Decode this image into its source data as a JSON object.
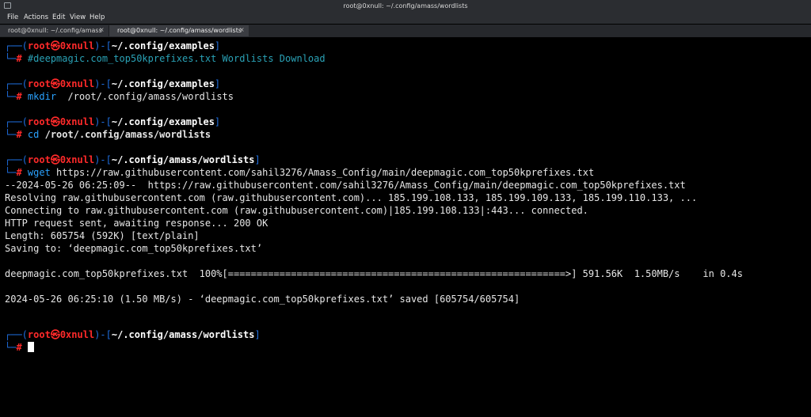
{
  "window": {
    "title": "root@0xnull: ~/.config/amass/wordlists"
  },
  "menu": {
    "file": "File",
    "actions": "Actions",
    "edit": "Edit",
    "view": "View",
    "help": "Help"
  },
  "tabs": [
    {
      "label": "root@0xnull: ~/.config/amass"
    },
    {
      "label": "root@0xnull: ~/.config/amass/wordlists"
    }
  ],
  "tab_close": "×",
  "prompt": {
    "open": "┌──(",
    "user": "root",
    "skull": "㉿",
    "host": "0xnull",
    "mid": ")-[",
    "close": "]",
    "second": "└─",
    "hash": "#"
  },
  "blocks": [
    {
      "path": "~/.config/examples",
      "command": "#deepmagic.com_top50kprefixes.txt Wordlists Download"
    },
    {
      "path": "~/.config/examples",
      "command_name": "mkdir",
      "command_args": "  /root/.config/amass/wordlists"
    },
    {
      "path": "~/.config/examples",
      "command_name": "cd",
      "command_args": " /root/.config/amass/wordlists"
    },
    {
      "path": "~/.config/amass/wordlists",
      "command_name": "wget",
      "command_args": " https://raw.githubusercontent.com/sahil3276/Amass_Config/main/deepmagic.com_top50kprefixes.txt"
    },
    {
      "path": "~/.config/amass/wordlists"
    }
  ],
  "output": [
    "--2024-05-26 06:25:09--  https://raw.githubusercontent.com/sahil3276/Amass_Config/main/deepmagic.com_top50kprefixes.txt",
    "Resolving raw.githubusercontent.com (raw.githubusercontent.com)... 185.199.108.133, 185.199.109.133, 185.199.110.133, ...",
    "Connecting to raw.githubusercontent.com (raw.githubusercontent.com)|185.199.108.133|:443... connected.",
    "HTTP request sent, awaiting response... 200 OK",
    "Length: 605754 (592K) [text/plain]",
    "Saving to: ‘deepmagic.com_top50kprefixes.txt’",
    "deepmagic.com_top50kprefixes.txt  100%[===========================================================>] 591.56K  1.50MB/s    in 0.4s",
    "2024-05-26 06:25:10 (1.50 MB/s) - ‘deepmagic.com_top50kprefixes.txt’ saved [605754/605754]"
  ]
}
